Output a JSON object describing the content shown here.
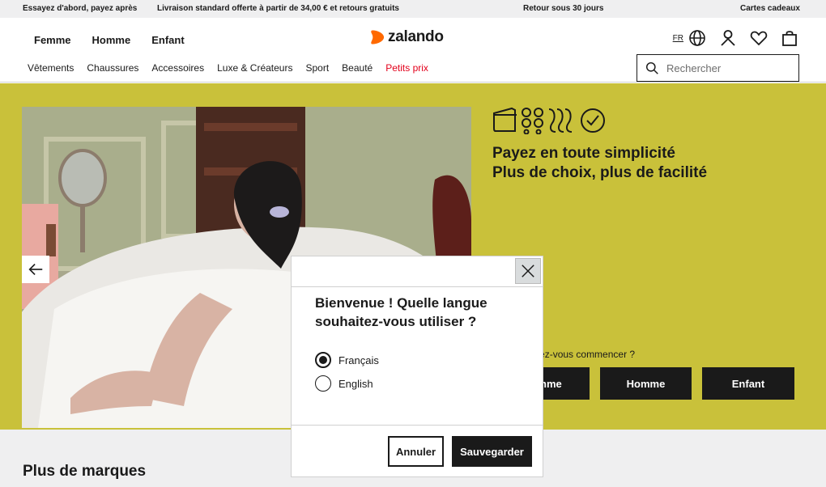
{
  "promo": {
    "items": [
      "Essayez d'abord, payez après",
      "Livraison standard offerte à partir de 34,00 € et retours gratuits",
      "Retour sous 30 jours",
      "Cartes cadeaux"
    ]
  },
  "header": {
    "gender_nav": [
      "Femme",
      "Homme",
      "Enfant"
    ],
    "logo_text": "zalando",
    "language_code": "FR",
    "categories": [
      "Vêtements",
      "Chaussures",
      "Accessoires",
      "Luxe & Créateurs",
      "Sport",
      "Beauté",
      "Petits prix"
    ],
    "search_placeholder": "Rechercher",
    "icons": [
      "globe-icon",
      "account-icon",
      "wishlist-heart-icon",
      "shopping-bag-icon"
    ]
  },
  "hero": {
    "title_line1": "Payez en toute simplicité",
    "title_line2": "Plus de choix, plus de facilité",
    "question": "Où souhaitez-vous commencer ?",
    "buttons": [
      "Femme",
      "Homme",
      "Enfant"
    ],
    "background_color": "#c9c13a"
  },
  "below": {
    "heading": "Plus de marques"
  },
  "modal": {
    "title": "Bienvenue ! Quelle langue souhaitez-vous utiliser ?",
    "options": [
      {
        "label": "Français",
        "selected": true
      },
      {
        "label": "English",
        "selected": false
      }
    ],
    "cancel_label": "Annuler",
    "save_label": "Sauvegarder"
  },
  "colors": {
    "brand_orange": "#ff6900",
    "sale_red": "#e3001b",
    "text_dark": "#1a1a1a"
  }
}
